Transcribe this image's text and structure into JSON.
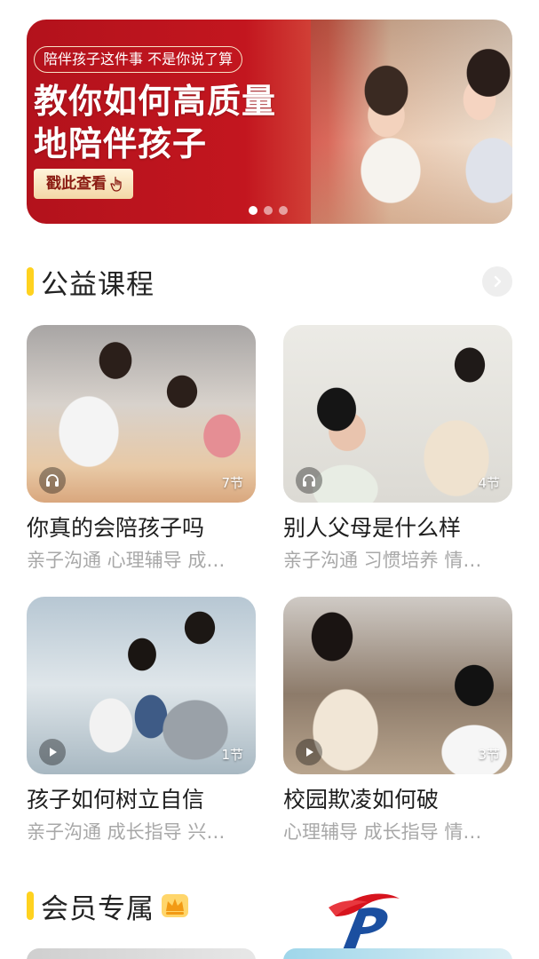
{
  "banner": {
    "tagline": "陪伴孩子这件事 不是你说了算",
    "headline_line1": "教你如何高质量",
    "headline_line2": "地陪伴孩子",
    "cta": "戳此查看",
    "slide_count": 3,
    "active_slide": 0
  },
  "sections": {
    "public_courses": {
      "title": "公益课程",
      "more_icon": "chevron-right-icon",
      "courses": [
        {
          "title": "你真的会陪孩子吗",
          "tags": "亲子沟通 心理辅导 成…",
          "lessons": "7节",
          "media_icon": "headphones-icon"
        },
        {
          "title": "别人父母是什么样",
          "tags": "亲子沟通 习惯培养 情…",
          "lessons": "4节",
          "media_icon": "headphones-icon"
        },
        {
          "title": "孩子如何树立自信",
          "tags": "亲子沟通 成长指导 兴…",
          "lessons": "1节",
          "media_icon": "play-icon"
        },
        {
          "title": "校园欺凌如何破",
          "tags": "心理辅导 成长指导 情…",
          "lessons": "3节",
          "media_icon": "play-icon"
        }
      ]
    },
    "member": {
      "title": "会员专属",
      "badge_icon": "crown-icon"
    }
  },
  "colors": {
    "accent": "#ffd21f",
    "banner_red": "#c3161f",
    "tag_gray": "#a8a8a8",
    "logo_red": "#d7141e",
    "logo_blue": "#1b4fa0"
  }
}
